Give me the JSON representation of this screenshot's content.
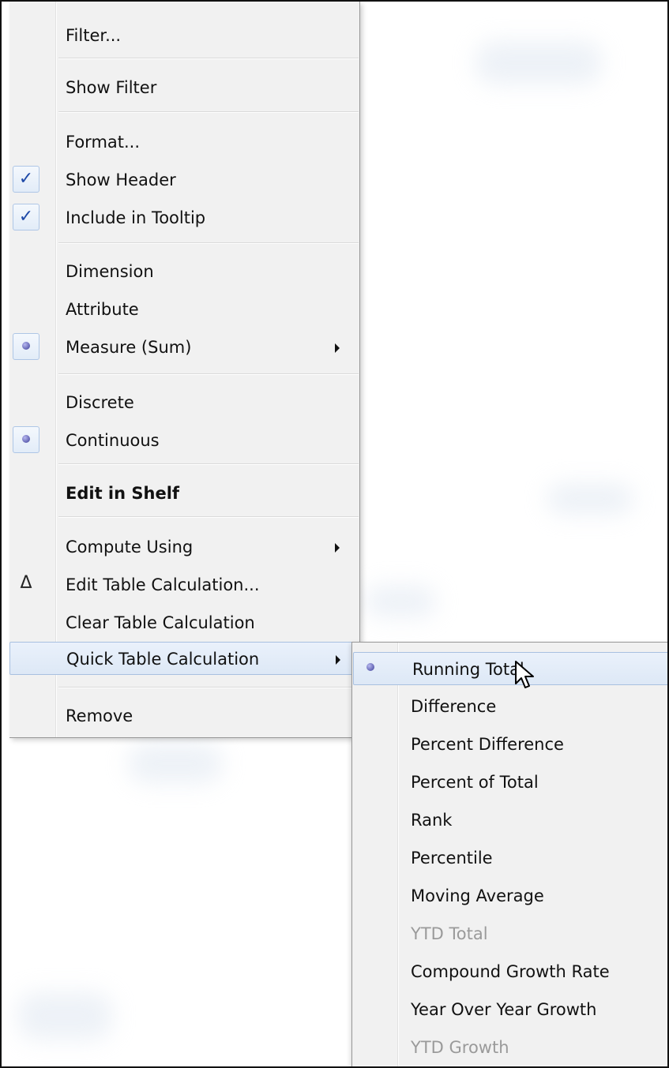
{
  "context_menu": {
    "items": [
      {
        "label": "Filter..."
      },
      {
        "label": "Show Filter"
      },
      {
        "label": "Format..."
      },
      {
        "label": "Show Header",
        "check": "✓"
      },
      {
        "label": "Include in Tooltip",
        "check": "✓"
      },
      {
        "label": "Dimension"
      },
      {
        "label": "Attribute"
      },
      {
        "label": "Measure (Sum)",
        "selected": true,
        "has_submenu": true
      },
      {
        "label": "Discrete"
      },
      {
        "label": "Continuous",
        "selected": true
      },
      {
        "label": "Edit in Shelf",
        "bold": true
      },
      {
        "label": "Compute Using",
        "has_submenu": true
      },
      {
        "label": "Edit Table Calculation...",
        "mark": "Δ"
      },
      {
        "label": "Clear Table Calculation"
      },
      {
        "label": "Quick Table Calculation",
        "has_submenu": true,
        "highlighted": true
      },
      {
        "label": "Remove"
      }
    ]
  },
  "quick_table_calculation_submenu": {
    "items": [
      {
        "label": "Running Total",
        "selected": true,
        "highlighted": true
      },
      {
        "label": "Difference"
      },
      {
        "label": "Percent Difference"
      },
      {
        "label": "Percent of Total"
      },
      {
        "label": "Rank"
      },
      {
        "label": "Percentile"
      },
      {
        "label": "Moving Average"
      },
      {
        "label": "YTD Total",
        "disabled": true
      },
      {
        "label": "Compound Growth Rate"
      },
      {
        "label": "Year Over Year Growth"
      },
      {
        "label": "YTD Growth",
        "disabled": true
      }
    ]
  },
  "colors": {
    "menu_background": "#f1f1f1",
    "highlight": "#dde8f6",
    "check": "#1f4aa8",
    "disabled_text": "#9a9a9a"
  },
  "icons": [
    "check-icon",
    "radio-dot-icon",
    "delta-icon",
    "submenu-arrow-icon",
    "mouse-pointer-icon"
  ]
}
